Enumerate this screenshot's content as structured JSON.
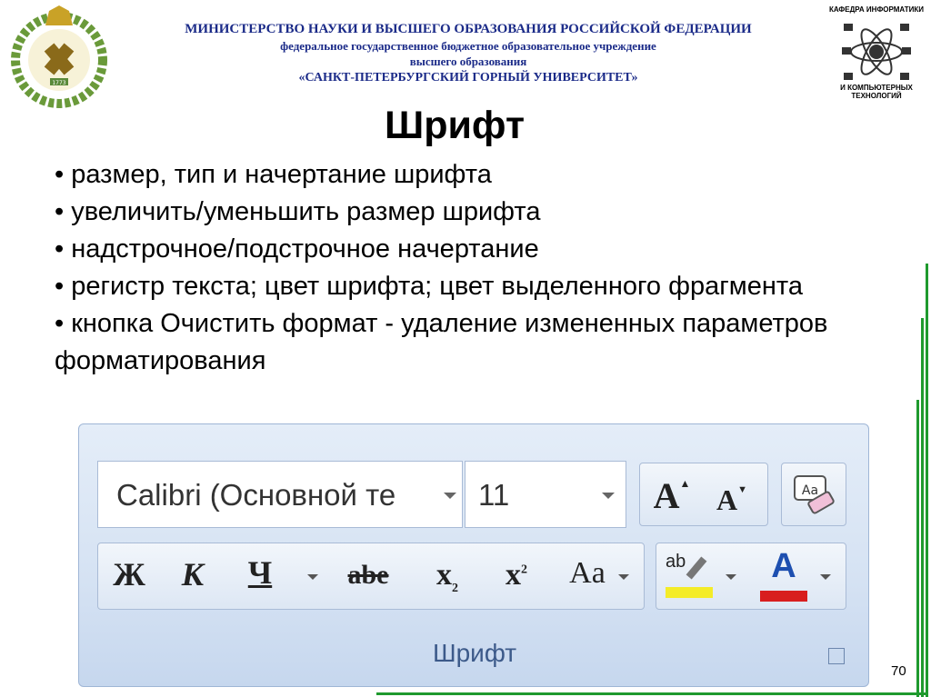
{
  "header": {
    "line1": "МИНИСТЕРСТВО НАУКИ И ВЫСШЕГО ОБРАЗОВАНИЯ РОССИЙСКОЙ ФЕДЕРАЦИИ",
    "line2": "федеральное государственное бюджетное образовательное учреждение",
    "line3": "высшего образования",
    "line4": "«САНКТ-ПЕТЕРБУРГСКИЙ ГОРНЫЙ УНИВЕРСИТЕТ»"
  },
  "crest": {
    "year": "1773",
    "icon": "university-crest-icon"
  },
  "department": {
    "top": "КАФЕДРА ИНФОРМАТИКИ",
    "bottom": "И КОМПЬЮТЕРНЫХ ТЕХНОЛОГИЙ",
    "icon": "computer-network-icon"
  },
  "title": "Шрифт",
  "bullets": [
    "• размер, тип и начертание шрифта",
    "• увеличить/уменьшить размер шрифта",
    "• надстрочное/подстрочное начертание",
    "• регистр текста; цвет шрифта; цвет выделенного фрагмента",
    "• кнопка Очистить формат - удаление измененных параметров форматирования"
  ],
  "ribbon": {
    "font_name": "Calibri (Основной те",
    "font_size": "11",
    "grow_label": "A",
    "shrink_label": "A",
    "clear_label": "Aa",
    "bold": "Ж",
    "italic": "К",
    "underline": "Ч",
    "strike": "abe",
    "subscript": "x",
    "subscript_index": "2",
    "superscript": "x",
    "superscript_index": "2",
    "case": "Aa",
    "highlight": "ab",
    "font_color": "A",
    "group_label": "Шрифт",
    "highlight_color": "#f4ec28",
    "font_color_bar": "#d81e1e"
  },
  "page_number": "70",
  "colors": {
    "header_text": "#1a2a88",
    "frame_green": "#1f9a2e"
  }
}
